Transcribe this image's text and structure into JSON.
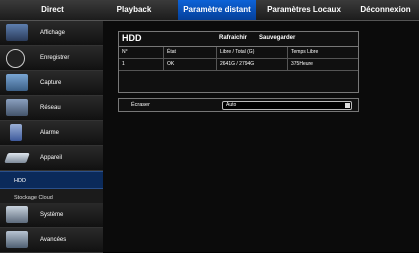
{
  "nav": {
    "tabs": [
      {
        "label": "Direct"
      },
      {
        "label": "Playback"
      },
      {
        "label": "Paramètre distant"
      },
      {
        "label": "Paramètres Locaux"
      },
      {
        "label": "Déconnexion"
      }
    ]
  },
  "sidebar": {
    "items": [
      {
        "label": "Affichage",
        "icon": "monitor-icon"
      },
      {
        "label": "Enregistrer",
        "icon": "film-reel-icon"
      },
      {
        "label": "Capture",
        "icon": "capture-icon"
      },
      {
        "label": "Réseau",
        "icon": "network-icon"
      },
      {
        "label": "Alarme",
        "icon": "alarm-icon"
      },
      {
        "label": "Appareil",
        "icon": "device-icon"
      },
      {
        "label": "Système",
        "icon": "system-icon"
      },
      {
        "label": "Avancées",
        "icon": "advanced-icon"
      }
    ],
    "subitems": [
      {
        "label": "HDD"
      },
      {
        "label": "Stockage Cloud"
      }
    ]
  },
  "hdd_panel": {
    "title": "HDD",
    "refresh_label": "Rafraichir",
    "save_label": "Sauvegarder",
    "columns": [
      "N°",
      "État",
      "Libre / Total (G)",
      "Temps Libre"
    ],
    "rows": [
      [
        "1",
        "OK",
        "2641G / 2794G",
        "375Heure"
      ]
    ]
  },
  "overwrite": {
    "label": "Écraser",
    "value": "Auto"
  },
  "colors": {
    "active_tab": "#0d63d8",
    "selected_subitem": "#0b2a5a"
  }
}
